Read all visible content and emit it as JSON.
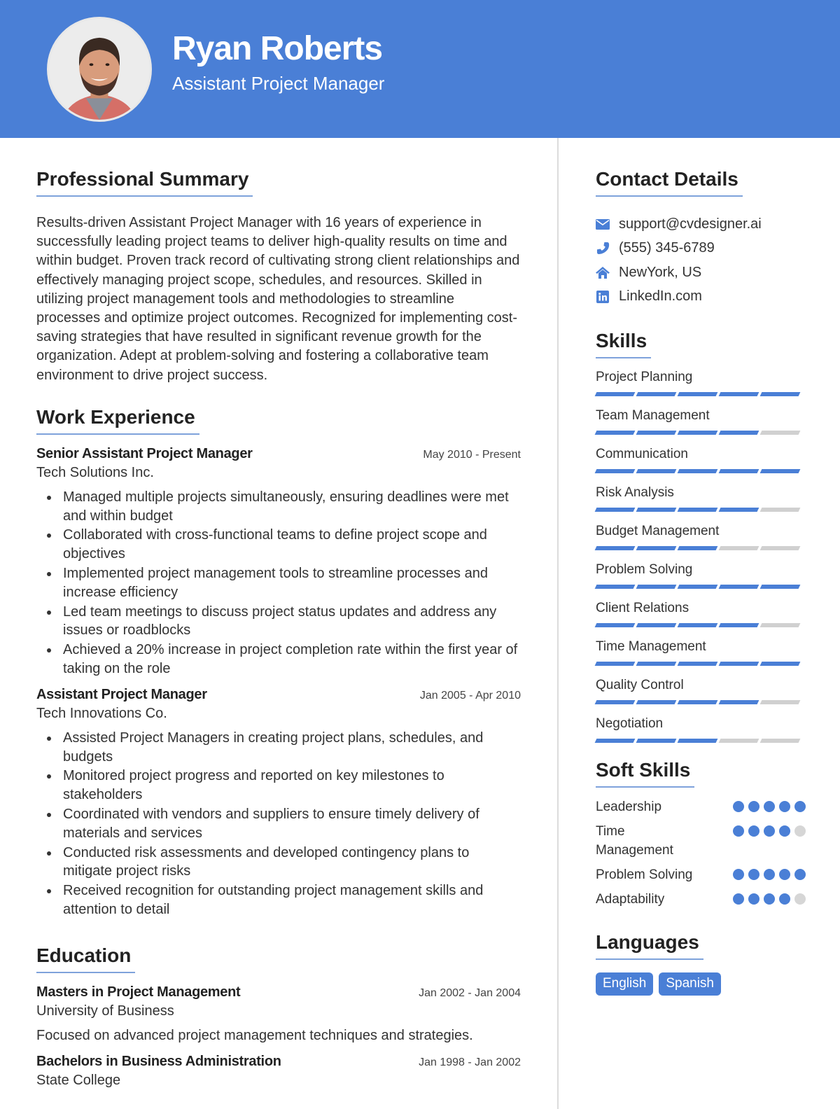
{
  "header": {
    "name": "Ryan Roberts",
    "title": "Assistant Project Manager",
    "accent_color": "#4a7fd6"
  },
  "summary": {
    "heading": "Professional Summary",
    "text": "Results-driven Assistant Project Manager with 16 years of experience in successfully leading project teams to deliver high-quality results on time and within budget. Proven track record of cultivating strong client relationships and effectively managing project scope, schedules, and resources. Skilled in utilizing project management tools and methodologies to streamline processes and optimize project outcomes. Recognized for implementing cost-saving strategies that have resulted in significant revenue growth for the organization. Adept at problem-solving and fostering a collaborative team environment to drive project success."
  },
  "experience": {
    "heading": "Work Experience",
    "jobs": [
      {
        "role": "Senior Assistant Project Manager",
        "dates": "May 2010 - Present",
        "company": "Tech Solutions Inc.",
        "bullets": [
          "Managed multiple projects simultaneously, ensuring deadlines were met and within budget",
          "Collaborated with cross-functional teams to define project scope and objectives",
          "Implemented project management tools to streamline processes and increase efficiency",
          "Led team meetings to discuss project status updates and address any issues or roadblocks",
          "Achieved a 20% increase in project completion rate within the first year of taking on the role"
        ]
      },
      {
        "role": "Assistant Project Manager",
        "dates": "Jan 2005 - Apr 2010",
        "company": "Tech Innovations Co.",
        "bullets": [
          "Assisted Project Managers in creating project plans, schedules, and budgets",
          "Monitored project progress and reported on key milestones to stakeholders",
          "Coordinated with vendors and suppliers to ensure timely delivery of materials and services",
          "Conducted risk assessments and developed contingency plans to mitigate project risks",
          "Received recognition for outstanding project management skills and attention to detail"
        ]
      }
    ]
  },
  "education": {
    "heading": "Education",
    "items": [
      {
        "degree": "Masters in Project Management",
        "dates": "Jan 2002 - Jan 2004",
        "school": "University of Business",
        "description": "Focused on advanced project management techniques and strategies."
      },
      {
        "degree": "Bachelors in Business Administration",
        "dates": "Jan 1998 - Jan 2002",
        "school": "State College"
      }
    ]
  },
  "contact": {
    "heading": "Contact Details",
    "items": [
      {
        "icon": "envelope-icon",
        "text": "support@cvdesigner.ai"
      },
      {
        "icon": "phone-icon",
        "text": "(555) 345-6789"
      },
      {
        "icon": "home-icon",
        "text": "NewYork, US"
      },
      {
        "icon": "linkedin-icon",
        "text": "LinkedIn.com"
      }
    ]
  },
  "skills": {
    "heading": "Skills",
    "max_level": 5,
    "items": [
      {
        "name": "Project Planning",
        "level": 5
      },
      {
        "name": "Team Management",
        "level": 4
      },
      {
        "name": "Communication",
        "level": 5
      },
      {
        "name": "Risk Analysis",
        "level": 4
      },
      {
        "name": "Budget Management",
        "level": 3
      },
      {
        "name": "Problem Solving",
        "level": 5
      },
      {
        "name": "Client Relations",
        "level": 4
      },
      {
        "name": "Time Management",
        "level": 5
      },
      {
        "name": "Quality Control",
        "level": 4
      },
      {
        "name": "Negotiation",
        "level": 3
      }
    ]
  },
  "soft_skills": {
    "heading": "Soft Skills",
    "max_level": 5,
    "items": [
      {
        "name": "Leadership",
        "level": 5
      },
      {
        "name": "Time Management",
        "level": 4
      },
      {
        "name": "Problem Solving",
        "level": 5
      },
      {
        "name": "Adaptability",
        "level": 4
      }
    ]
  },
  "languages": {
    "heading": "Languages",
    "items": [
      "English",
      "Spanish"
    ]
  }
}
